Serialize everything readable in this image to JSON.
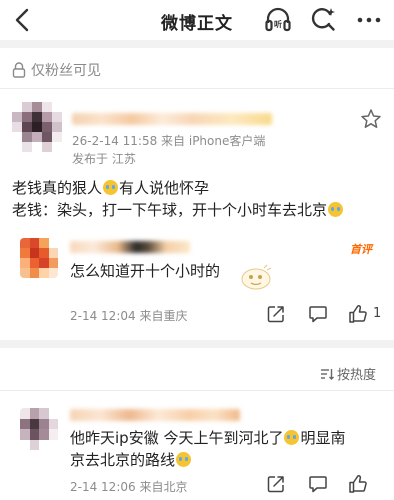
{
  "header": {
    "title": "微博正文",
    "icons": [
      "back-icon",
      "listen-icon",
      "search-icon",
      "more-icon"
    ]
  },
  "privacy": {
    "label": "仅粉丝可见",
    "icon": "lock-icon"
  },
  "post": {
    "meta_line": "26-2-14 11:58  来自 iPhone客户端",
    "location": "发布于 江苏",
    "text_line1_a": "老钱真的狠人",
    "text_line1_b": "有人说他怀孕",
    "text_line2_a": "老钱：染头，打一下午球，开十个小时车去北京",
    "favorite_icon": "star-icon"
  },
  "reply": {
    "badge": "首评",
    "text": "怎么知道开十个小时的",
    "meta": "2-14 12:04  来自重庆",
    "like_count": "1"
  },
  "comment_sort": {
    "label": "按热度"
  },
  "comment": {
    "text_line1_a": "他昨天ip安徽  今天上午到河北了",
    "text_line1_b": "明显南",
    "text_line2_a": "京去北京的路线",
    "meta": "2-14 12:06  来自北京"
  },
  "colors": {
    "orange_accent": "#ff6a00",
    "muted_text": "#8c8c8c",
    "divider": "#f2f2f2"
  }
}
